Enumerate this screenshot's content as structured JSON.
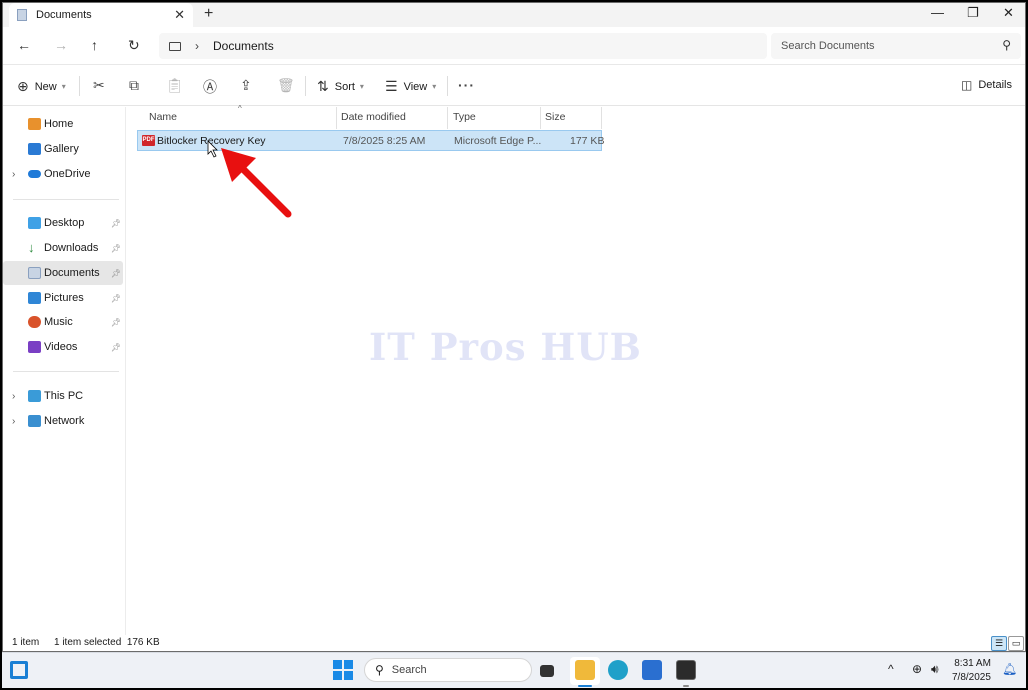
{
  "window": {
    "tab_title": "Documents",
    "new_tab": "+",
    "controls": {
      "minimize": "—",
      "maximize": "❐",
      "close": "✕"
    }
  },
  "nav": {
    "back": "←",
    "forward": "→",
    "up": "↑",
    "refresh": "↻",
    "breadcrumb_sep": "›",
    "breadcrumb": "Documents",
    "search_placeholder": "Search Documents"
  },
  "commands": {
    "new": "New",
    "sort": "Sort",
    "view": "View",
    "more": "···",
    "details": "Details"
  },
  "sidebar": {
    "items": [
      {
        "label": "Home",
        "icon": "home-icon",
        "color": "#e8912d"
      },
      {
        "label": "Gallery",
        "icon": "gallery-icon",
        "color": "#2a7ad4"
      },
      {
        "label": "OneDrive",
        "icon": "cloud-icon",
        "color": "#1f7ad8"
      },
      {
        "label": "Desktop",
        "icon": "desktop-icon",
        "color": "#3fa1e6"
      },
      {
        "label": "Downloads",
        "icon": "download-icon",
        "color": "#2d8a3e"
      },
      {
        "label": "Documents",
        "icon": "documents-icon",
        "color": "#8aa0bf"
      },
      {
        "label": "Pictures",
        "icon": "pictures-icon",
        "color": "#2f86d6"
      },
      {
        "label": "Music",
        "icon": "music-icon",
        "color": "#d9532b"
      },
      {
        "label": "Videos",
        "icon": "videos-icon",
        "color": "#7a3fc4"
      },
      {
        "label": "This PC",
        "icon": "pc-icon",
        "color": "#3a9bd8"
      },
      {
        "label": "Network",
        "icon": "network-icon",
        "color": "#3a8fd0"
      }
    ]
  },
  "columns": [
    "Name",
    "Date modified",
    "Type",
    "Size"
  ],
  "files": [
    {
      "name": "Bitlocker Recovery Key",
      "date": "7/8/2025 8:25 AM",
      "type": "Microsoft Edge P...",
      "size": "177 KB",
      "icon_text": "PDF"
    }
  ],
  "watermark": "IT Pros HUB",
  "status": {
    "count": "1 item",
    "selection": "1 item selected  176 KB"
  },
  "taskbar": {
    "search_label": "Search",
    "time": "8:31 AM",
    "date": "7/8/2025"
  }
}
